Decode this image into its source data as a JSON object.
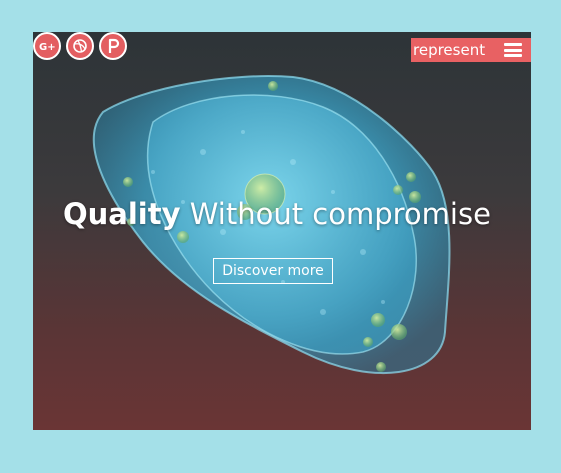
{
  "social": [
    {
      "icon": "google-plus-icon",
      "glyph": "G+"
    },
    {
      "icon": "dribbble-icon",
      "glyph": "dribbble"
    },
    {
      "icon": "pinterest-icon",
      "glyph": "P"
    }
  ],
  "menu": {
    "label": "represent",
    "icon": "hamburger-icon"
  },
  "hero": {
    "title_strong": "Quality",
    "title_rest": " Without compromise",
    "cta_label": "Discover more"
  },
  "colors": {
    "background": "#a4e0e8",
    "accent": "#e86163",
    "gradient_top": "#2d3438",
    "gradient_bottom": "#6a3535",
    "cell": "#3fb3d6"
  }
}
